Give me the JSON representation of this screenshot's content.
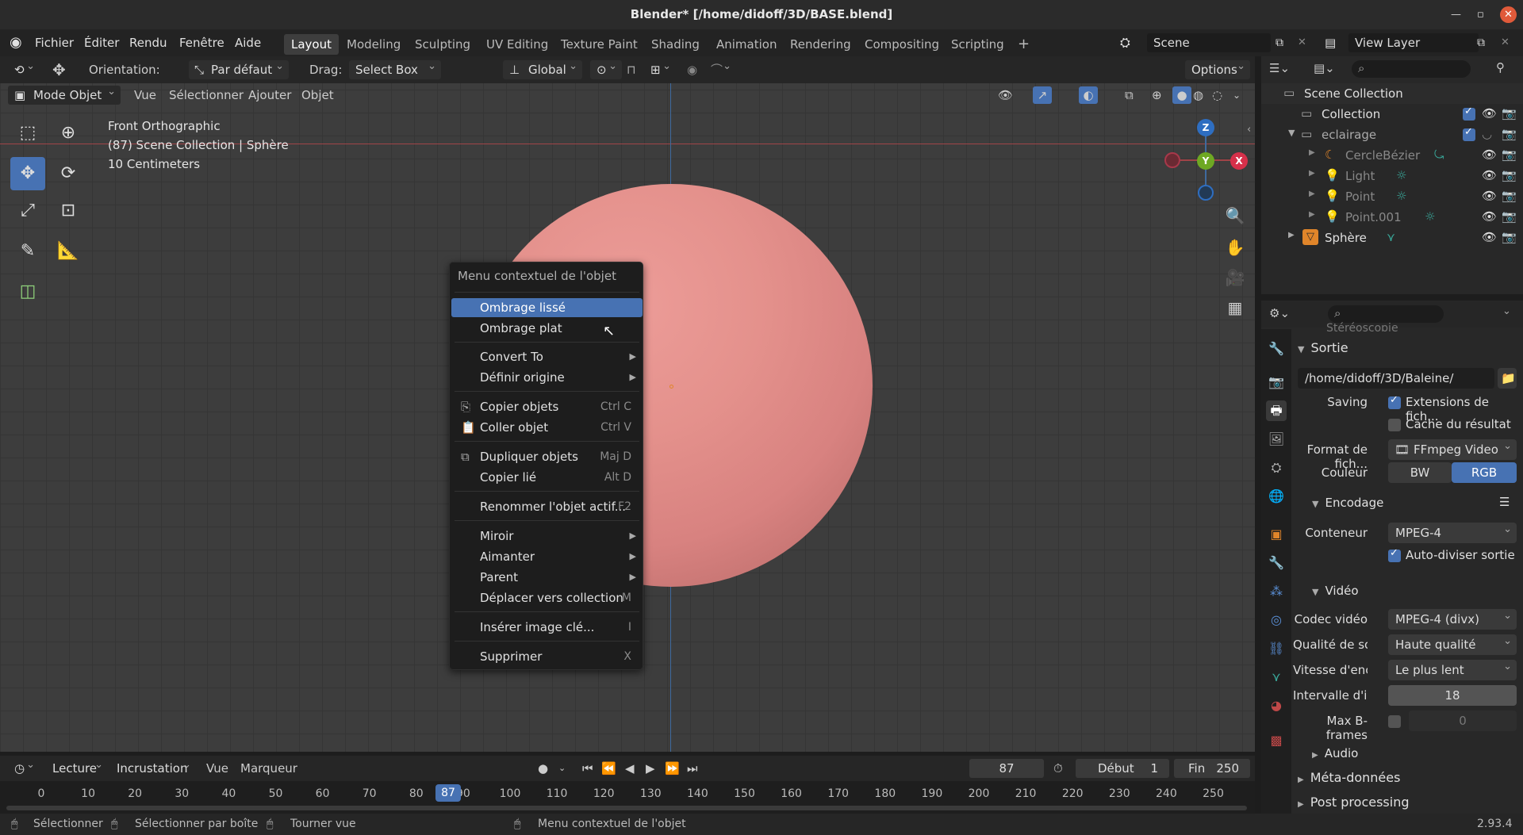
{
  "window": {
    "title": "Blender* [/home/didoff/3D/BASE.blend]"
  },
  "menu": {
    "items": [
      "Fichier",
      "Éditer",
      "Rendu",
      "Fenêtre",
      "Aide"
    ]
  },
  "workspaces": [
    "Layout",
    "Modeling",
    "Sculpting",
    "UV Editing",
    "Texture Paint",
    "Shading",
    "Animation",
    "Rendering",
    "Compositing",
    "Scripting"
  ],
  "scene": {
    "name": "Scene",
    "view_layer": "View Layer"
  },
  "toolheader": {
    "orientation_label": "Orientation:",
    "orientation_value": "Par défaut",
    "drag_label": "Drag:",
    "drag_value": "Select Box",
    "transform_orientation": "Global",
    "options_label": "Options"
  },
  "viewport_header": {
    "mode": "Mode Objet",
    "menus": [
      "Vue",
      "Sélectionner",
      "Ajouter",
      "Objet"
    ]
  },
  "viewport_info": [
    "Front Orthographic",
    "(87) Scene Collection | Sphère",
    "10 Centimeters"
  ],
  "gizmo": {
    "z": "Z",
    "y": "Y",
    "x": "X"
  },
  "context_menu": {
    "title": "Menu contextuel de l'objet",
    "items": [
      {
        "label": "Ombrage lissé",
        "shortcut": ""
      },
      {
        "label": "Ombrage plat",
        "shortcut": ""
      },
      {
        "label": "Convert To",
        "shortcut": ""
      },
      {
        "label": "Définir origine",
        "shortcut": ""
      },
      {
        "label": "Copier objets",
        "shortcut": "Ctrl C"
      },
      {
        "label": "Coller objet",
        "shortcut": "Ctrl V"
      },
      {
        "label": "Dupliquer objets",
        "shortcut": "Maj D"
      },
      {
        "label": "Copier lié",
        "shortcut": "Alt D"
      },
      {
        "label": "Renommer l'objet actif...",
        "shortcut": "F2"
      },
      {
        "label": "Miroir",
        "shortcut": ""
      },
      {
        "label": "Aimanter",
        "shortcut": ""
      },
      {
        "label": "Parent",
        "shortcut": ""
      },
      {
        "label": "Déplacer vers collection",
        "shortcut": "M"
      },
      {
        "label": "Insérer image clé...",
        "shortcut": "I"
      },
      {
        "label": "Supprimer",
        "shortcut": "X"
      }
    ]
  },
  "outliner": {
    "root": "Scene Collection",
    "rows": [
      "Collection",
      "eclairage",
      "CercleBézier",
      "Light",
      "Point",
      "Point.001",
      "Sphère"
    ]
  },
  "properties": {
    "section_partial": "Stéréoscopie",
    "sortie": "Sortie",
    "path": "/home/didoff/3D/Baleine/",
    "saving_label": "Saving",
    "ext_label": "Extensions de fich...",
    "cache_label": "Cache du résultat",
    "format_label": "Format de fich...",
    "format_value": "FFmpeg Video",
    "couleur_label": "Couleur",
    "bw": "BW",
    "rgb": "RGB",
    "encodage": "Encodage",
    "conteneur_label": "Conteneur",
    "conteneur_value": "MPEG-4",
    "autosplit_label": "Auto-diviser sortie",
    "video": "Vidéo",
    "codec_label": "Codec vidéo",
    "codec_value": "MPEG-4 (divx)",
    "quality_label": "Qualité de sor...",
    "quality_value": "Haute qualité",
    "speed_label": "Vitesse d'enco...",
    "speed_value": "Le plus lent",
    "interval_label": "Intervalle d'im...",
    "interval_value": "18",
    "bframes_label": "Max B-frames",
    "bframes_value": "0",
    "audio": "Audio",
    "meta": "Méta-données",
    "post": "Post processing"
  },
  "timeline": {
    "menus": [
      "Lecture",
      "Incrustation",
      "Vue",
      "Marqueur"
    ],
    "current_frame": "87",
    "start_label": "Début",
    "start": "1",
    "end_label": "Fin",
    "end": "250",
    "ticks": [
      "0",
      "10",
      "20",
      "30",
      "40",
      "50",
      "60",
      "70",
      "80",
      "90",
      "100",
      "110",
      "120",
      "130",
      "140",
      "150",
      "160",
      "170",
      "180",
      "190",
      "200",
      "210",
      "220",
      "230",
      "240",
      "250"
    ]
  },
  "status": {
    "select": "Sélectionner",
    "box_select": "Sélectionner par boîte",
    "rotate": "Tourner vue",
    "context": "Menu contextuel de l'objet",
    "version": "2.93.4"
  }
}
